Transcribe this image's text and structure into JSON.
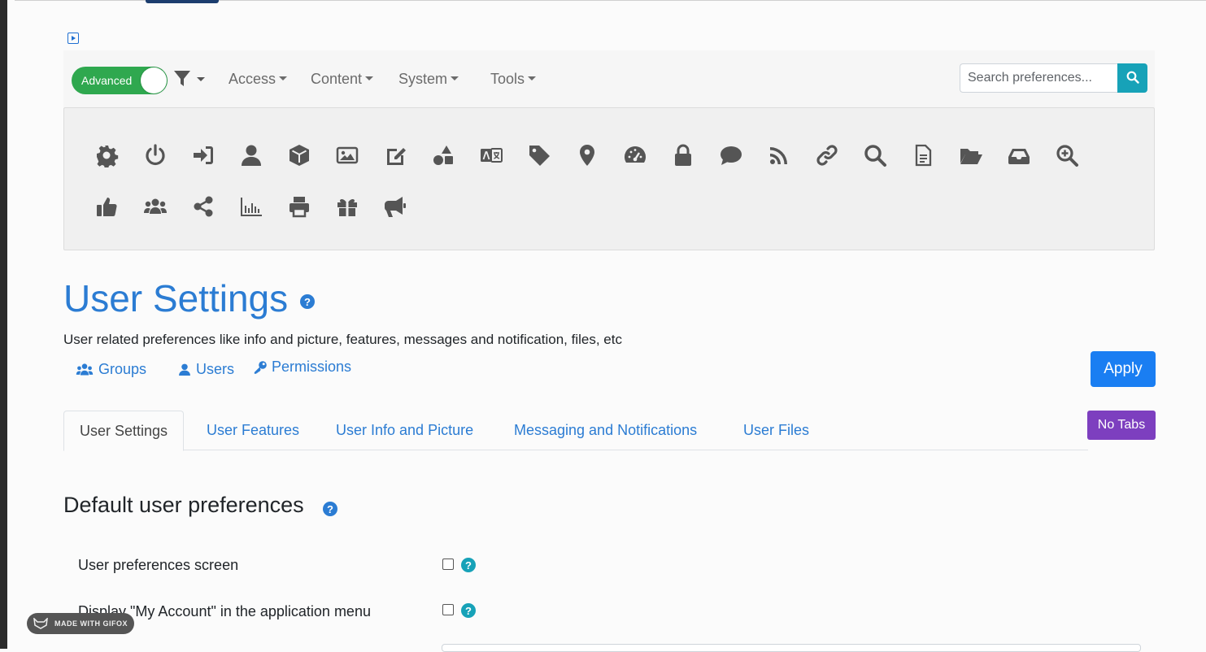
{
  "toolbar": {
    "advanced_label": "Advanced",
    "menus": [
      "Access",
      "Content",
      "System",
      "Tools"
    ],
    "search_placeholder": "Search preferences..."
  },
  "icon_grid": [
    "gear-icon",
    "power-icon",
    "sign-in-icon",
    "user-icon",
    "cube-icon",
    "image-icon",
    "edit-icon",
    "shapes-icon",
    "translate-icon",
    "tag-icon",
    "map-marker-icon",
    "dashboard-icon",
    "lock-icon",
    "comment-icon",
    "rss-icon",
    "link-icon",
    "search-icon",
    "file-icon",
    "folder-open-icon",
    "inbox-icon",
    "zoom-in-icon",
    "thumbs-up-icon",
    "users-icon",
    "share-icon",
    "bar-chart-icon",
    "print-icon",
    "gift-icon",
    "megaphone-icon"
  ],
  "page": {
    "title": "User Settings",
    "help": "?",
    "description": "User related preferences like info and picture, features, messages and notification, files, etc",
    "links": {
      "groups": "Groups",
      "users": "Users",
      "permissions": "Permissions"
    },
    "apply_label": "Apply",
    "no_tabs_label": "No Tabs"
  },
  "tabs": [
    "User Settings",
    "User Features",
    "User Info and Picture",
    "Messaging and Notifications",
    "User Files"
  ],
  "section": {
    "title": "Default user preferences",
    "help": "?",
    "prefs": [
      {
        "label": "User preferences screen",
        "checked": false,
        "help": "?"
      },
      {
        "label": "Display \"My Account\" in the application menu",
        "checked": false,
        "help": "?"
      }
    ]
  },
  "watermark": "MADE WITH GIFOX",
  "colors": {
    "primary": "#2b7cd3",
    "toggle_on": "#2fa84f",
    "info": "#17a2b8",
    "no_tabs": "#7d3fbf",
    "apply": "#1a7ef2"
  }
}
